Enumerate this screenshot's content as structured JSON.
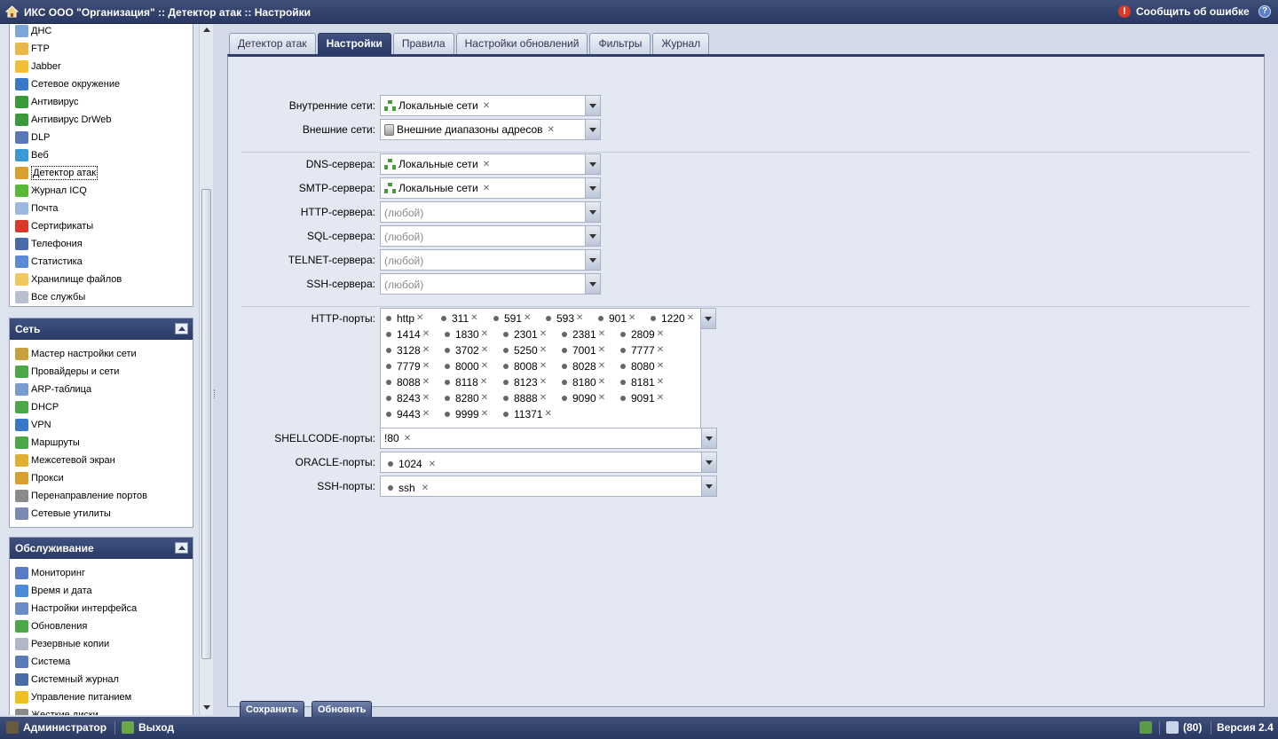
{
  "app": {
    "title": "ИКС ООО \"Организация\" :: Детектор атак :: Настройки",
    "report_label": "Сообщить об ошибке"
  },
  "services_menu": [
    {
      "label": "ДНС",
      "icon": "dns-icon",
      "color": "#7ea7d8"
    },
    {
      "label": "FTP",
      "icon": "ftp-icon",
      "color": "#e8b84a"
    },
    {
      "label": "Jabber",
      "icon": "jabber-icon",
      "color": "#f0c030"
    },
    {
      "label": "Сетевое окружение",
      "icon": "network-neighborhood-icon",
      "color": "#3a78c8"
    },
    {
      "label": "Антивирус",
      "icon": "antivirus-icon",
      "color": "#3a9a3a"
    },
    {
      "label": "Антивирус DrWeb",
      "icon": "drweb-icon",
      "color": "#3a9a3a"
    },
    {
      "label": "DLP",
      "icon": "dlp-eye-icon",
      "color": "#5a78b8"
    },
    {
      "label": "Веб",
      "icon": "web-globe-icon",
      "color": "#3a9ad8"
    },
    {
      "label": "Детектор атак",
      "icon": "attack-detector-icon",
      "color": "#d8a030"
    },
    {
      "label": "Журнал ICQ",
      "icon": "icq-icon",
      "color": "#58b838"
    },
    {
      "label": "Почта",
      "icon": "mail-icon",
      "color": "#9ab8e0"
    },
    {
      "label": "Сертификаты",
      "icon": "certificate-icon",
      "color": "#d83a2a"
    },
    {
      "label": "Телефония",
      "icon": "telephony-icon",
      "color": "#4a6aa8"
    },
    {
      "label": "Статистика",
      "icon": "statistics-icon",
      "color": "#5a8ad8"
    },
    {
      "label": "Хранилище файлов",
      "icon": "folder-icon",
      "color": "#f0c860"
    },
    {
      "label": "Все службы",
      "icon": "all-services-icon",
      "color": "#b8c0d0"
    }
  ],
  "network_box": {
    "title": "Сеть",
    "items": [
      {
        "label": "Мастер настройки сети",
        "icon": "wizard-wand-icon",
        "color": "#c8a040"
      },
      {
        "label": "Провайдеры и сети",
        "icon": "globe-icon",
        "color": "#4aa848"
      },
      {
        "label": "ARP-таблица",
        "icon": "arp-table-icon",
        "color": "#7a9ad0"
      },
      {
        "label": "DHCP",
        "icon": "dhcp-icon",
        "color": "#4aa848"
      },
      {
        "label": "VPN",
        "icon": "vpn-icon",
        "color": "#3a78c8"
      },
      {
        "label": "Маршруты",
        "icon": "routes-icon",
        "color": "#4aa848"
      },
      {
        "label": "Межсетевой экран",
        "icon": "firewall-shield-icon",
        "color": "#e0b030"
      },
      {
        "label": "Прокси",
        "icon": "proxy-lock-icon",
        "color": "#d8a030"
      },
      {
        "label": "Перенаправление портов",
        "icon": "port-forward-icon",
        "color": "#8a8a8a"
      },
      {
        "label": "Сетевые утилиты",
        "icon": "network-tools-icon",
        "color": "#7a8ab0"
      }
    ]
  },
  "maintenance_box": {
    "title": "Обслуживание",
    "items": [
      {
        "label": "Мониторинг",
        "icon": "monitoring-icon",
        "color": "#5a7ac8"
      },
      {
        "label": "Время и дата",
        "icon": "clock-icon",
        "color": "#4a8ad8"
      },
      {
        "label": "Настройки интерфейса",
        "icon": "interface-settings-icon",
        "color": "#6a8ac8"
      },
      {
        "label": "Обновления",
        "icon": "update-arrow-icon",
        "color": "#4aa848"
      },
      {
        "label": "Резервные копии",
        "icon": "backup-icon",
        "color": "#b0b8c8"
      },
      {
        "label": "Система",
        "icon": "system-monitor-icon",
        "color": "#5a7ab8"
      },
      {
        "label": "Системный журнал",
        "icon": "system-log-book-icon",
        "color": "#4a6aa8"
      },
      {
        "label": "Управление питанием",
        "icon": "power-lightning-icon",
        "color": "#f0c020"
      },
      {
        "label": "Жесткие диски",
        "icon": "hard-disk-icon",
        "color": "#8a8a8a"
      }
    ]
  },
  "tabs": [
    {
      "label": "Детектор атак",
      "active": false
    },
    {
      "label": "Настройки",
      "active": true
    },
    {
      "label": "Правила",
      "active": false
    },
    {
      "label": "Настройки обновлений",
      "active": false
    },
    {
      "label": "Фильтры",
      "active": false
    },
    {
      "label": "Журнал",
      "active": false
    }
  ],
  "form": {
    "internal_nets": {
      "label": "Внутренние сети:",
      "value": "Локальные сети"
    },
    "external_nets": {
      "label": "Внешние сети:",
      "value": "Внешние диапазоны адресов"
    },
    "dns_servers": {
      "label": "DNS-сервера:",
      "value": "Локальные сети"
    },
    "smtp_servers": {
      "label": "SMTP-сервера:",
      "value": "Локальные сети"
    },
    "http_servers": {
      "label": "HTTP-сервера:",
      "placeholder": "(любой)"
    },
    "sql_servers": {
      "label": "SQL-сервера:",
      "placeholder": "(любой)"
    },
    "telnet_servers": {
      "label": "TELNET-сервера:",
      "placeholder": "(любой)"
    },
    "ssh_servers": {
      "label": "SSH-сервера:",
      "placeholder": "(любой)"
    },
    "http_ports": {
      "label": "HTTP-порты:",
      "values": [
        "http",
        "311",
        "591",
        "593",
        "901",
        "1220",
        "1414",
        "1830",
        "2301",
        "2381",
        "2809",
        "3128",
        "3702",
        "5250",
        "7001",
        "7777",
        "7779",
        "8000",
        "8008",
        "8028",
        "8080",
        "8088",
        "8118",
        "8123",
        "8180",
        "8181",
        "8243",
        "8280",
        "8888",
        "9090",
        "9091",
        "9443",
        "9999",
        "11371"
      ]
    },
    "shellcode_ports": {
      "label": "SHELLCODE-порты:",
      "values": [
        "!80"
      ]
    },
    "oracle_ports": {
      "label": "ORACLE-порты:",
      "values": [
        "1024"
      ]
    },
    "ssh_ports": {
      "label": "SSH-порты:",
      "values": [
        "ssh"
      ]
    }
  },
  "buttons": {
    "save": "Сохранить",
    "refresh": "Обновить"
  },
  "footer": {
    "user": "Администратор",
    "logout": "Выход",
    "messages": "(80)",
    "version": "Версия 2.4"
  },
  "colors": {
    "header_bg": "#2d3c68",
    "panel_bg": "#e4e8f2",
    "error_icon": "#d83a2a"
  }
}
